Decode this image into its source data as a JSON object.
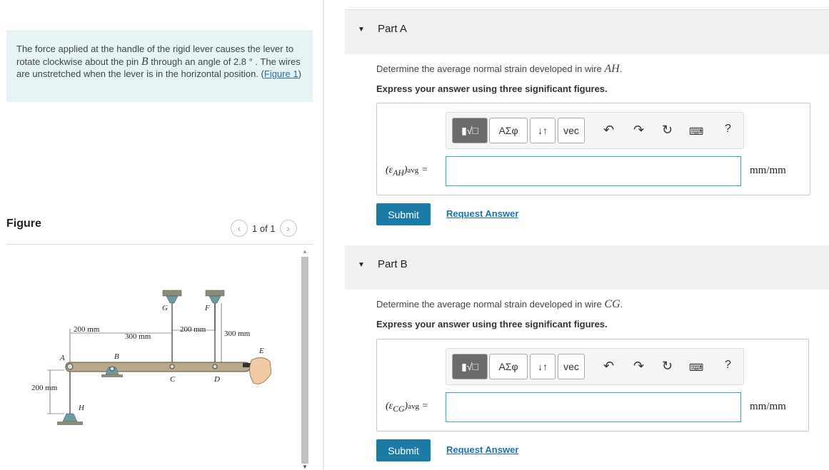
{
  "problem": {
    "text_1": "The force applied at the handle of the rigid lever causes the lever to rotate clockwise about the pin ",
    "pin_var": "B",
    "text_2": " through an angle of 2.8 ° . The wires are unstretched when the lever is in the horizontal position. (",
    "figure_link": "Figure 1",
    "text_3": ")"
  },
  "figure_panel": {
    "title": "Figure",
    "pager": "1 of 1",
    "prev_icon": "chevron-left-icon",
    "next_icon": "chevron-right-icon"
  },
  "figure": {
    "labels": {
      "A": "A",
      "B": "B",
      "C": "C",
      "D": "D",
      "E": "E",
      "F": "F",
      "G": "G",
      "H": "H"
    },
    "dims": {
      "d1": "200 mm",
      "d2": "300 mm",
      "d3": "200 mm",
      "d4": "300 mm",
      "d5": "200 mm"
    }
  },
  "parts": [
    {
      "label": "Part A",
      "question_text": "Determine the average normal strain developed in wire ",
      "wire": "AH",
      "question_end": ".",
      "instruction": "Express your answer using three significant figures.",
      "symbol": "ε",
      "subscript": "AH",
      "avg": "avg",
      "equals": "=",
      "unit": "mm/mm",
      "input_value": "",
      "submit": "Submit",
      "request": "Request Answer"
    },
    {
      "label": "Part B",
      "question_text": "Determine the average normal strain developed in wire ",
      "wire": "CG",
      "question_end": ".",
      "instruction": "Express your answer using three significant figures.",
      "symbol": "ε",
      "subscript": "CG",
      "avg": "avg",
      "equals": "=",
      "unit": "mm/mm",
      "input_value": "",
      "submit": "Submit",
      "request": "Request Answer"
    }
  ],
  "toolbar": {
    "greek": "ΑΣφ",
    "arrows": "↓↑",
    "vec": "vec",
    "help": "?"
  },
  "colors": {
    "accent": "#1b7aa6",
    "link": "#1a73b5",
    "problem_bg": "#e7f4f6",
    "input_border": "#3aa3c1"
  }
}
